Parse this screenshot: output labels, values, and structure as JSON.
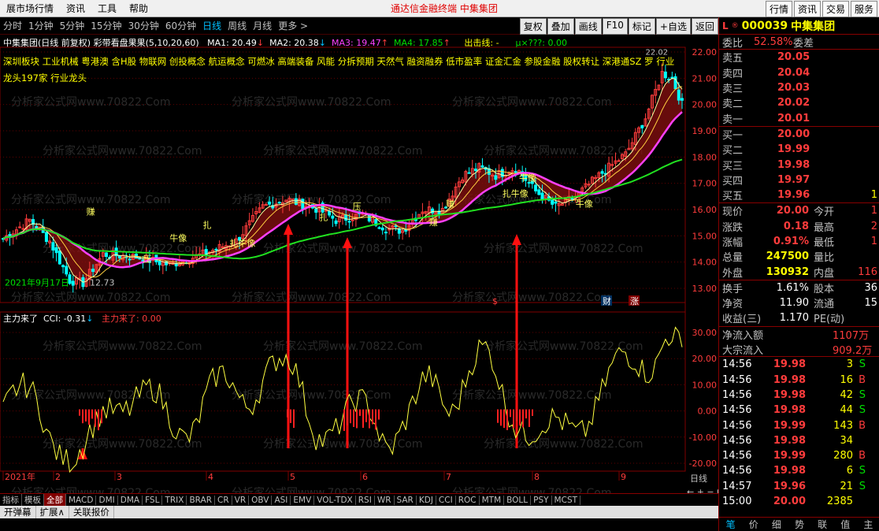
{
  "menu": {
    "items": [
      "展市场行情",
      "资讯",
      "工具",
      "帮助"
    ],
    "center_text": "通达信金融终端    中集集团",
    "right_buttons": [
      "行情",
      "资讯",
      "交易",
      "服务"
    ]
  },
  "toolbar": {
    "periods": [
      "分时",
      "1分钟",
      "5分钟",
      "15分钟",
      "30分钟",
      "60分钟",
      "日线",
      "周线",
      "月线",
      "更多 >"
    ],
    "active": "日线",
    "right_buttons": [
      "复权",
      "叠加",
      "画线",
      "F10",
      "标记",
      "+自选",
      "返回"
    ]
  },
  "chart": {
    "info_title": "中集集团(日线 前复权) 彩带看盘果果(5,10,20,60)",
    "ma1": "MA1: 20.49",
    "ma2": "MA2: 20.38",
    "ma3": "MA3: 19.47",
    "ma4": "MA4: 17.85",
    "exit_line": "出击线: -",
    "mu": "μ×???: 0.00",
    "concepts": "深圳板块 工业机械 粤港澳 含H股 物联网 创投概念 航运概念 可燃冰 高端装备 风能 分拆预期 天然气 融资融券 低市盈率 证金汇金 参股金融 股权转让 深港通SZ 罗 行业龙头197家 行业龙头",
    "date_label": "2021年9月17日",
    "low_label": "12.73",
    "high_label": "22.02",
    "ticks_main": [
      "22.00",
      "21.00",
      "20.00",
      "19.00",
      "18.00",
      "17.00",
      "16.00",
      "15.00",
      "14.00",
      "13.00"
    ],
    "ticks_sub": [
      "30.00",
      "20.00",
      "10.00",
      "0.00",
      "-10.00",
      "-20.00"
    ],
    "x_labels": [
      "2021年",
      "2",
      "3",
      "4",
      "5",
      "6",
      "7",
      "8",
      "9"
    ],
    "sub_title": "主力来了",
    "sub_cci": "CCI: -0.31",
    "sub_zlll": "主力来了: 0.00",
    "period_label": "日线",
    "annotations": [
      "财",
      "涨",
      "$"
    ],
    "watermark": "分析家公式网www.70822.Com",
    "signals": [
      "赚",
      "压",
      "扎",
      "牛像",
      "扎牛像",
      "压",
      "扎",
      "赚",
      "扎牛像",
      "牛像",
      "赚",
      "牛像"
    ]
  },
  "bottom_tabs": [
    "指标",
    "模板",
    "全部",
    "MACD",
    "DMI",
    "DMA",
    "FSL",
    "TRIX",
    "BRAR",
    "CR",
    "VR",
    "OBV",
    "ASI",
    "EMV",
    "VOL-TDX",
    "RSI",
    "WR",
    "SAR",
    "KDJ",
    "CCI",
    "ROC",
    "MTM",
    "BOLL",
    "PSY",
    "MCST"
  ],
  "bottom_active": "全部",
  "statusbar": [
    "开弹幕",
    "扩展∧",
    "关联报价"
  ],
  "quote": {
    "header_prefix": "L",
    "header_code": "000039",
    "header_name": "中集集团",
    "wei_bi_label": "委比",
    "wei_bi": "52.58%",
    "wei_cha_label": "委差",
    "sells": [
      {
        "label": "卖五",
        "price": "20.05"
      },
      {
        "label": "卖四",
        "price": "20.04"
      },
      {
        "label": "卖三",
        "price": "20.03"
      },
      {
        "label": "卖二",
        "price": "20.02"
      },
      {
        "label": "卖一",
        "price": "20.01"
      }
    ],
    "buys": [
      {
        "label": "买一",
        "price": "20.00"
      },
      {
        "label": "买二",
        "price": "19.99"
      },
      {
        "label": "买三",
        "price": "19.98"
      },
      {
        "label": "买四",
        "price": "19.97"
      },
      {
        "label": "买五",
        "price": "19.96"
      }
    ],
    "buy5_vol": "1",
    "stats": [
      {
        "l1": "现价",
        "v1": "20.00",
        "l2": "今开",
        "v2": "1"
      },
      {
        "l1": "涨跌",
        "v1": "0.18",
        "l2": "最高",
        "v2": "2"
      },
      {
        "l1": "涨幅",
        "v1": "0.91%",
        "l2": "最低",
        "v2": "1"
      },
      {
        "l1": "总量",
        "v1": "247500",
        "l2": "量比",
        "v2": ""
      },
      {
        "l1": "外盘",
        "v1": "130932",
        "l2": "内盘",
        "v2": "116"
      }
    ],
    "stats2": [
      {
        "l1": "换手",
        "v1": "1.61%",
        "l2": "股本",
        "v2": "36"
      },
      {
        "l1": "净资",
        "v1": "11.90",
        "l2": "流通",
        "v2": "15"
      },
      {
        "l1": "收益(三)",
        "v1": "1.170",
        "l2": "PE(动)",
        "v2": ""
      }
    ],
    "net_inflow_label": "净流入额",
    "net_inflow": "1107万",
    "block_label": "大宗流入",
    "block": "909.2万",
    "trades": [
      {
        "t": "14:56",
        "p": "19.98",
        "v": "3",
        "d": "S"
      },
      {
        "t": "14:56",
        "p": "19.98",
        "v": "16",
        "d": "B"
      },
      {
        "t": "14:56",
        "p": "19.98",
        "v": "42",
        "d": "S"
      },
      {
        "t": "14:56",
        "p": "19.98",
        "v": "44",
        "d": "S"
      },
      {
        "t": "14:56",
        "p": "19.99",
        "v": "143",
        "d": "B"
      },
      {
        "t": "14:56",
        "p": "19.98",
        "v": "34",
        "d": ""
      },
      {
        "t": "14:56",
        "p": "19.99",
        "v": "280",
        "d": "B"
      },
      {
        "t": "14:56",
        "p": "19.98",
        "v": "6",
        "d": "S"
      },
      {
        "t": "14:57",
        "p": "19.96",
        "v": "21",
        "d": "S"
      },
      {
        "t": "15:00",
        "p": "20.00",
        "v": "2385",
        "d": ""
      }
    ],
    "tabs": [
      "笔",
      "价",
      "细",
      "势",
      "联",
      "值",
      "主"
    ]
  },
  "colors": {
    "up": "#ff3c3c",
    "down": "#00ffff",
    "ma_magenta": "#ff40ff",
    "ma_green": "#20e020",
    "band_fill": "#8a1010",
    "cci_line": "#ffff40"
  }
}
